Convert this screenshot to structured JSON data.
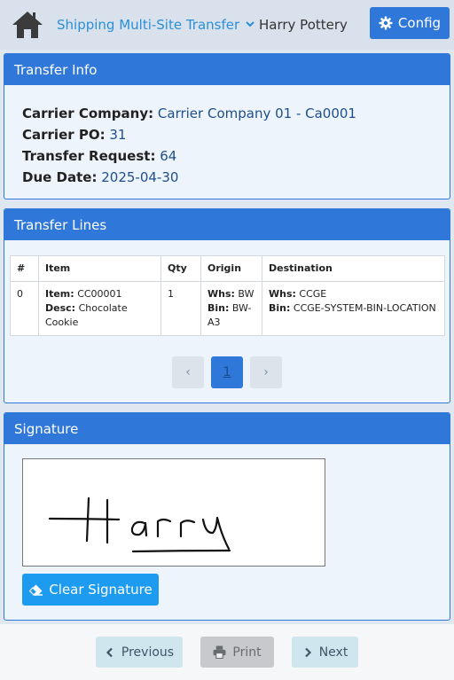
{
  "header": {
    "module_title": "Shipping Multi-Site Transfer",
    "user_name": "Harry Pottery",
    "config_label": "Config"
  },
  "transfer_info": {
    "heading": "Transfer Info",
    "fields": [
      {
        "label": "Carrier Company:",
        "value": "Carrier Company 01 - Ca0001"
      },
      {
        "label": "Carrier PO:",
        "value": "31"
      },
      {
        "label": "Transfer Request:",
        "value": "64"
      },
      {
        "label": "Due Date:",
        "value": "2025-04-30"
      }
    ]
  },
  "transfer_lines": {
    "heading": "Transfer Lines",
    "columns": [
      "#",
      "Item",
      "Qty",
      "Origin",
      "Destination"
    ],
    "rows": [
      {
        "num": "0",
        "item_label": "Item:",
        "item_value": "CC00001",
        "desc_label": "Desc:",
        "desc_value": "Chocolate Cookie",
        "qty": "1",
        "origin_whs_label": "Whs:",
        "origin_whs": "BW",
        "origin_bin_label": "Bin:",
        "origin_bin": "BW-A3",
        "dest_whs_label": "Whs:",
        "dest_whs": "CCGE",
        "dest_bin_label": "Bin:",
        "dest_bin": "CCGE-SYSTEM-BIN-LOCATION"
      }
    ],
    "pagination": {
      "prev": "‹",
      "current": "1",
      "next": "›"
    }
  },
  "signature": {
    "heading": "Signature",
    "signed_text": "Harry",
    "clear_label": "Clear Signature"
  },
  "footer": {
    "previous_label": "Previous",
    "print_label": "Print",
    "next_label": "Next"
  },
  "colors": {
    "primary": "#2f77d9",
    "accent_button": "#1d9bf0",
    "value_text": "#1e4e8c",
    "link_text": "#2a8fd8"
  }
}
